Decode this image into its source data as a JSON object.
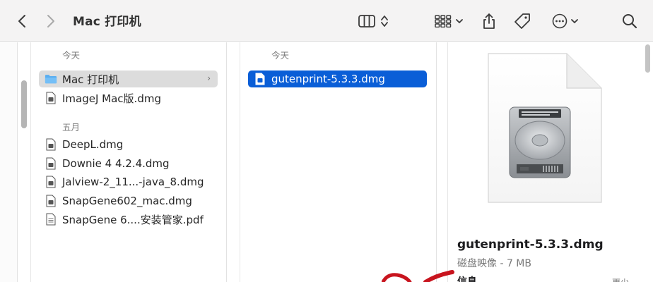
{
  "toolbar": {
    "title": "Mac 打印机",
    "icons": [
      "chevron-left-icon",
      "chevron-right-icon",
      "columns-view-icon",
      "up-down-chevron-icon",
      "grid-group-icon",
      "share-icon",
      "tag-icon",
      "more-icon",
      "search-icon"
    ]
  },
  "column1": {
    "sections": [
      {
        "label": "今天",
        "items": [
          {
            "name": "Mac 打印机",
            "kind": "folder",
            "selected": true
          },
          {
            "name": "ImageJ Mac版.dmg",
            "kind": "file"
          }
        ]
      },
      {
        "label": "五月",
        "items": [
          {
            "name": "DeepL.dmg",
            "kind": "file"
          },
          {
            "name": "Downie 4 4.2.4.dmg",
            "kind": "file"
          },
          {
            "name": "Jalview-2_11...-java_8.dmg",
            "kind": "file"
          },
          {
            "name": "SnapGene602_mac.dmg",
            "kind": "file"
          },
          {
            "name": "SnapGene 6....安装管家.pdf",
            "kind": "pdf"
          }
        ]
      }
    ]
  },
  "column2": {
    "section_label": "今天",
    "items": [
      {
        "name": "gutenprint-5.3.3.dmg",
        "kind": "file",
        "selected": true
      }
    ]
  },
  "preview": {
    "file_name": "gutenprint-5.3.3.dmg",
    "meta": "磁盘映像 - 7 MB",
    "info_heading": "信息",
    "more_label": "更少"
  },
  "colors": {
    "selection_blue": "#0a5ed7",
    "selection_grey": "#dcdcdc",
    "toolbar_bg": "#f4f3f3",
    "folder_blue": "#5aaef0"
  }
}
